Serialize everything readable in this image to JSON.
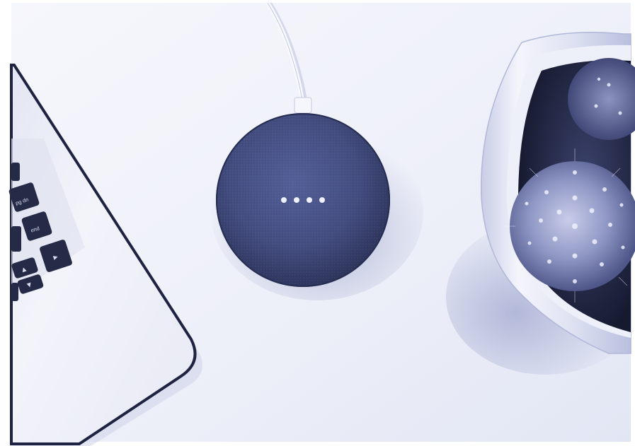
{
  "scene": {
    "description_type": "photo",
    "palette": {
      "surface": "#f1f3fb",
      "speaker_fabric": "#434d78",
      "speaker_light": "#eef1ff",
      "laptop_body": "#eff1f8",
      "laptop_edge": "#1d2340",
      "key_cap": "#252b46",
      "cable": "#f7f8fd",
      "pot": "#dfe3f4",
      "cactus": "#9ea6cf"
    },
    "laptop": {
      "keys": [
        {
          "id": "pgdn",
          "label": "pg dn"
        },
        {
          "id": "end",
          "label": "end"
        },
        {
          "id": "up",
          "label": "▲"
        },
        {
          "id": "down",
          "label": "▼"
        },
        {
          "id": "right",
          "label": "▶"
        }
      ]
    },
    "speaker": {
      "led_count": 4
    }
  }
}
